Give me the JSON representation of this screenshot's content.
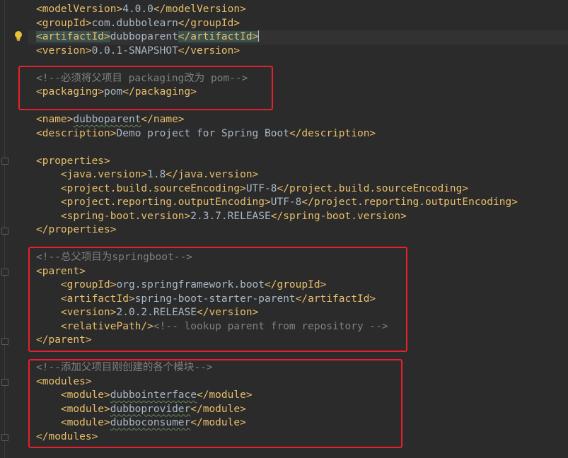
{
  "lines": {
    "l01": {
      "o1": "<modelVersion>",
      "t": "4.0.0",
      "c1": "</modelVersion>"
    },
    "l02": {
      "o1": "<groupId>",
      "t": "com.dubbolearn",
      "c1": "</groupId>"
    },
    "l03": {
      "o1": "<artifactId>",
      "t": "dubboparent",
      "c1": "</artifactId>"
    },
    "l04": {
      "o1": "<version>",
      "t": "0.0.1-SNAPSHOT",
      "c1": "</version>"
    },
    "l05": {
      "cm": "<!--必须将父项目 packaging改为 pom-->"
    },
    "l06": {
      "o1": "<packaging>",
      "t": "pom",
      "c1": "</packaging>"
    },
    "l07": {
      "o1": "<name>",
      "t": "dubboparent",
      "c1": "</name>"
    },
    "l08": {
      "o1": "<description>",
      "t": "Demo project for Spring Boot",
      "c1": "</description>"
    },
    "l09": {
      "o1": "<properties>"
    },
    "l10": {
      "o1": "<java.version>",
      "t": "1.8",
      "c1": "</java.version>"
    },
    "l11": {
      "o1": "<project.build.sourceEncoding>",
      "t": "UTF-8",
      "c1": "</project.build.sourceEncoding>"
    },
    "l12": {
      "o1": "<project.reporting.outputEncoding>",
      "t": "UTF-8",
      "c1": "</project.reporting.outputEncoding>"
    },
    "l13": {
      "o1": "<spring-boot.version>",
      "t": "2.3.7.RELEASE",
      "c1": "</spring-boot.version>"
    },
    "l14": {
      "c1": "</properties>"
    },
    "l15": {
      "cm": "<!--总父项目为springboot-->"
    },
    "l16": {
      "o1": "<parent>"
    },
    "l17": {
      "o1": "<groupId>",
      "t": "org.springframework.boot",
      "c1": "</groupId>"
    },
    "l18": {
      "o1": "<artifactId>",
      "t": "spring-boot-starter-parent",
      "c1": "</artifactId>"
    },
    "l19": {
      "o1": "<version>",
      "t": "2.0.2.RELEASE",
      "c1": "</version>"
    },
    "l20": {
      "o1": "<relativePath/>",
      "cm": "<!-- lookup parent from repository -->"
    },
    "l21": {
      "c1": "</parent>"
    },
    "l22": {
      "cm": "<!--添加父项目刚创建的各个模块-->"
    },
    "l23": {
      "o1": "<modules>"
    },
    "l24": {
      "o1": "<module>",
      "t": "dubbointerface",
      "c1": "</module>"
    },
    "l25": {
      "o1": "<module>",
      "t": "dubboprovider",
      "c1": "</module>"
    },
    "l26": {
      "o1": "<module>",
      "t": "dubboconsumer",
      "c1": "</module>"
    },
    "l27": {
      "c1": "</modules>"
    }
  },
  "colors": {
    "background": "#2b2b2b",
    "tag": "#e8bf6a",
    "text": "#a9b7c6",
    "comment": "#808080",
    "annotation_box": "#e8202a"
  },
  "icons": {
    "gutter": "lightbulb-icon"
  }
}
